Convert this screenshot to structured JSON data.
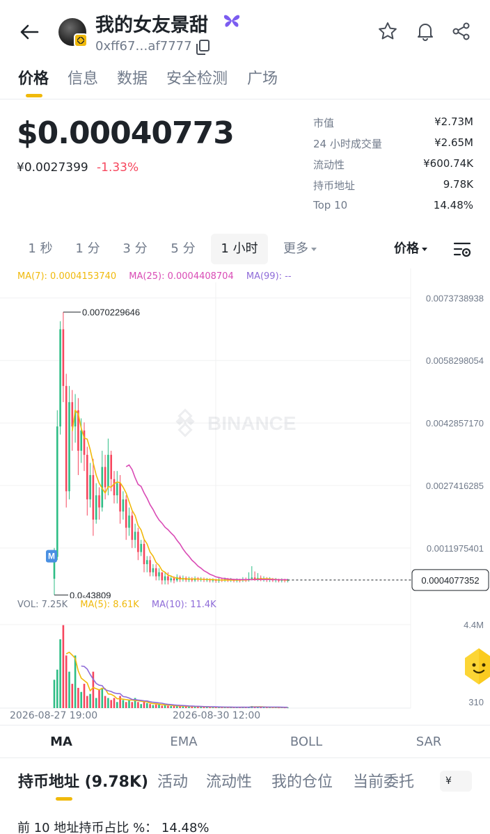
{
  "header": {
    "token_name": "我的女友景甜",
    "address": "0xff67…af7777",
    "icons": [
      "back-arrow-icon",
      "butterfly-icon",
      "copy-icon",
      "star-icon",
      "bell-icon",
      "share-icon"
    ]
  },
  "tabs": [
    "价格",
    "信息",
    "数据",
    "安全检测",
    "广场"
  ],
  "price": {
    "usd": "$0.00040773",
    "cny": "¥0.0027399",
    "change": "-1.33%",
    "change_color": "#f6465d"
  },
  "stats": [
    {
      "label": "市值",
      "value": "¥2.73M"
    },
    {
      "label": "24 小时成交量",
      "value": "¥2.65M"
    },
    {
      "label": "流动性",
      "value": "¥600.74K"
    },
    {
      "label": "持币地址",
      "value": "9.78K"
    },
    {
      "label": "Top 10",
      "value": "14.48%"
    }
  ],
  "intervals": [
    "1 秒",
    "1 分",
    "3 分",
    "5 分",
    "1 小时",
    "更多"
  ],
  "active_interval": "1 小时",
  "price_selector": "价格",
  "ma_legend": {
    "ma7": "MA(7): 0.0004153740",
    "ma25": "MA(25): 0.0004408704",
    "ma99": "MA(99): --"
  },
  "vol_legend": {
    "vol": "VOL: 7.25K",
    "ma5": "MA(5): 8.61K",
    "ma10": "MA(10): 11.4K"
  },
  "colors": {
    "up": "#2ebd85",
    "down": "#f6465d",
    "ma7": "#f0b90b",
    "ma25": "#d94bb5",
    "ma99": "#8e6bd8",
    "accent": "#f0b90b"
  },
  "chart_data": {
    "type": "candlestick",
    "y_ticks": [
      "0.0073738938",
      "0.0058298054",
      "0.0042857170",
      "0.0027416285",
      "0.0011975401"
    ],
    "y_range": [
      -4e-05,
      0.0081
    ],
    "high_label": "0.0070229646",
    "low_label": "0.0₅43809",
    "current_price_label": "0.0004077352",
    "current_price": 0.0004077352,
    "marker_label": "M",
    "x_labels": [
      "2026-08-27 19:00",
      "2026-08-30 12:00"
    ],
    "vol_ticks": [
      "4.4M",
      "310"
    ],
    "candles": [
      [
        0.00044,
        0.00098,
        4e-05,
        0.0012
      ],
      [
        0.00098,
        0.0042,
        0.0009,
        0.0046
      ],
      [
        0.0042,
        0.0066,
        0.004,
        0.0068
      ],
      [
        0.0066,
        0.0052,
        0.0048,
        0.0070229646
      ],
      [
        0.0052,
        0.0026,
        0.0022,
        0.0055
      ],
      [
        0.0026,
        0.0048,
        0.0024,
        0.0052
      ],
      [
        0.0048,
        0.0042,
        0.0036,
        0.0051
      ],
      [
        0.0042,
        0.0046,
        0.0038,
        0.005
      ],
      [
        0.0046,
        0.0036,
        0.003,
        0.0049
      ],
      [
        0.0036,
        0.0041,
        0.0033,
        0.0044
      ],
      [
        0.0041,
        0.0035,
        0.0031,
        0.0043
      ],
      [
        0.0035,
        0.0024,
        0.002,
        0.0037
      ],
      [
        0.0024,
        0.003,
        0.0022,
        0.0033
      ],
      [
        0.003,
        0.0019,
        0.0015,
        0.0034
      ],
      [
        0.0019,
        0.0025,
        0.0018,
        0.0028
      ],
      [
        0.0025,
        0.0022,
        0.0019,
        0.0027
      ],
      [
        0.0022,
        0.0032,
        0.0021,
        0.0036
      ],
      [
        0.0032,
        0.0027,
        0.0024,
        0.0035
      ],
      [
        0.0027,
        0.0035,
        0.0025,
        0.0039
      ],
      [
        0.0035,
        0.0029,
        0.0026,
        0.0036
      ],
      [
        0.0029,
        0.0025,
        0.0023,
        0.0031
      ],
      [
        0.0025,
        0.0028,
        0.0023,
        0.0031
      ],
      [
        0.0028,
        0.0021,
        0.0018,
        0.003
      ],
      [
        0.0021,
        0.0024,
        0.0019,
        0.0026
      ],
      [
        0.0024,
        0.0017,
        0.0014,
        0.0025
      ],
      [
        0.0017,
        0.002,
        0.0015,
        0.0022
      ],
      [
        0.002,
        0.0014,
        0.0012,
        0.0021
      ],
      [
        0.0014,
        0.0016,
        0.0012,
        0.0018
      ],
      [
        0.0016,
        0.0011,
        0.0009,
        0.0017
      ],
      [
        0.0011,
        0.0013,
        0.001,
        0.0014
      ],
      [
        0.0013,
        0.0008,
        0.0006,
        0.0014
      ],
      [
        0.0008,
        0.0009,
        0.0006,
        0.001
      ],
      [
        0.0009,
        0.0006,
        0.0005,
        0.001
      ],
      [
        0.0006,
        0.0007,
        0.0005,
        0.0008
      ],
      [
        0.0007,
        0.0005,
        0.0004,
        0.0008
      ],
      [
        0.0005,
        0.0006,
        0.0004,
        0.0007
      ],
      [
        0.0006,
        0.0004,
        0.0003,
        0.0006
      ],
      [
        0.0004,
        0.0005,
        0.0003,
        0.0006
      ],
      [
        0.0005,
        0.0004,
        0.0003,
        0.0006
      ],
      [
        0.0004,
        0.00045,
        0.00035,
        0.0005
      ],
      [
        0.00045,
        0.0004,
        0.00033,
        0.0005
      ],
      [
        0.0004,
        0.00048,
        0.00036,
        0.00055
      ],
      [
        0.00048,
        0.00042,
        0.00036,
        0.00052
      ],
      [
        0.00042,
        0.00046,
        0.00037,
        0.00052
      ],
      [
        0.00046,
        0.00041,
        0.00036,
        0.0005
      ],
      [
        0.00041,
        0.00044,
        0.00036,
        0.00049
      ],
      [
        0.00044,
        0.0004,
        0.00036,
        0.00048
      ],
      [
        0.0004,
        0.00045,
        0.00036,
        0.0005
      ],
      [
        0.00045,
        0.00042,
        0.00037,
        0.00048
      ],
      [
        0.00042,
        0.00043,
        0.00037,
        0.00048
      ],
      [
        0.00043,
        0.00041,
        0.00036,
        0.00047
      ],
      [
        0.00041,
        0.00042,
        0.00036,
        0.00046
      ],
      [
        0.00042,
        0.0004,
        0.00035,
        0.00045
      ],
      [
        0.0004,
        0.00041,
        0.00035,
        0.00045
      ],
      [
        0.00041,
        0.00039,
        0.00034,
        0.00044
      ],
      [
        0.00039,
        0.00042,
        0.00034,
        0.00046
      ],
      [
        0.00042,
        0.0004,
        0.00036,
        0.00045
      ],
      [
        0.0004,
        0.00043,
        0.00036,
        0.00047
      ],
      [
        0.00043,
        0.0004,
        0.00036,
        0.00046
      ],
      [
        0.0004,
        0.00042,
        0.00036,
        0.00046
      ],
      [
        0.00042,
        0.00039,
        0.00035,
        0.00044
      ],
      [
        0.00039,
        0.00041,
        0.00035,
        0.00045
      ],
      [
        0.00041,
        0.0004,
        0.00035,
        0.00044
      ],
      [
        0.0004,
        0.00043,
        0.00036,
        0.00048
      ],
      [
        0.00043,
        0.00041,
        0.00036,
        0.00047
      ],
      [
        0.00041,
        0.00044,
        0.00037,
        0.0006
      ],
      [
        0.00044,
        0.00047,
        0.0004,
        0.00075
      ],
      [
        0.00047,
        0.00043,
        0.00039,
        0.00062
      ],
      [
        0.00043,
        0.00046,
        0.00038,
        0.00058
      ],
      [
        0.00046,
        0.00042,
        0.00038,
        0.00052
      ],
      [
        0.00042,
        0.00044,
        0.00037,
        0.0005
      ],
      [
        0.00044,
        0.00041,
        0.00036,
        0.00048
      ],
      [
        0.00041,
        0.00043,
        0.00036,
        0.00048
      ],
      [
        0.00043,
        0.0004,
        0.00036,
        0.00046
      ],
      [
        0.0004,
        0.00042,
        0.00035,
        0.00046
      ],
      [
        0.00042,
        0.00039,
        0.00035,
        0.00044
      ],
      [
        0.00039,
        0.00041,
        0.00035,
        0.00045
      ],
      [
        0.00041,
        0.0004,
        0.00035,
        0.00044
      ],
      [
        0.0004,
        0.000407735,
        0.00035,
        0.00044
      ]
    ],
    "volumes": [
      1.4,
      1.9,
      3.4,
      4.1,
      2.6,
      1.8,
      1.2,
      2.6,
      1.0,
      0.8,
      1.2,
      0.6,
      0.7,
      1.8,
      0.5,
      0.9,
      1.0,
      0.6,
      0.5,
      0.4,
      0.5,
      0.3,
      0.6,
      0.4,
      0.3,
      0.4,
      0.3,
      0.5,
      0.3,
      0.2,
      0.3,
      0.25,
      0.2,
      0.15,
      0.18,
      0.2,
      0.12,
      0.15,
      0.12,
      0.1,
      0.12,
      0.1,
      0.09,
      0.08,
      0.09,
      0.08,
      0.07,
      0.08,
      0.07,
      0.06,
      0.05,
      0.06,
      0.05,
      0.05,
      0.04,
      0.05,
      0.04,
      0.04,
      0.04,
      0.05,
      0.04,
      0.04,
      0.04,
      0.05,
      0.04,
      0.06,
      0.1,
      0.06,
      0.05,
      0.05,
      0.04,
      0.04,
      0.04,
      0.04,
      0.04,
      0.03,
      0.04,
      0.03,
      0.03
    ]
  },
  "indicator_tabs": [
    "MA",
    "EMA",
    "BOLL",
    "SAR"
  ],
  "bottom_tabs": [
    "持币地址 (9.78K)",
    "活动",
    "流动性",
    "我的仓位",
    "当前委托"
  ],
  "currency_button": "¥",
  "top10_summary": "前 10 地址持币占比 %： 14.48%",
  "watermark": "BINANCE"
}
